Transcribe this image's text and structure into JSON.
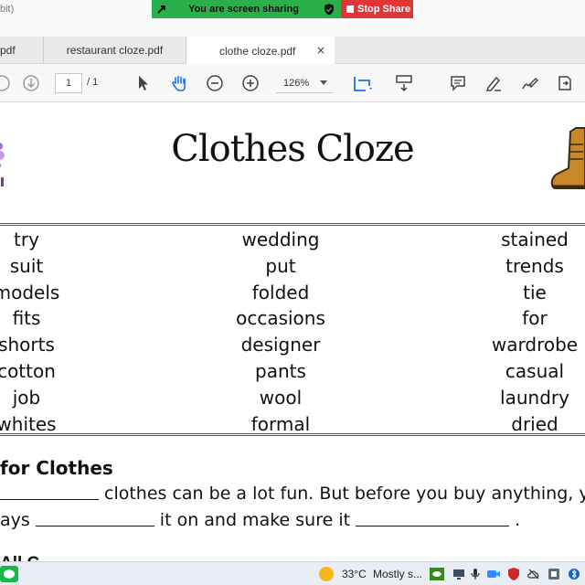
{
  "window": {
    "title_fragment": "bit)"
  },
  "share_bar": {
    "message": "You are screen sharing",
    "stop_label": "Stop Share"
  },
  "tabs": [
    {
      "label": "pdf"
    },
    {
      "label": "restaurant cloze.pdf"
    },
    {
      "label": "clothe cloze.pdf",
      "active": true
    }
  ],
  "tab_close": "×",
  "toolbar": {
    "page_current": "1",
    "page_total": "/ 1",
    "zoom": "126%"
  },
  "document": {
    "title": "Clothes Cloze",
    "word_bank": {
      "col1": [
        "try",
        "suit",
        "models",
        "fits",
        "shorts",
        "cotton",
        "job",
        "whites"
      ],
      "col2": [
        "wedding",
        "put",
        "folded",
        "occasions",
        "designer",
        "pants",
        "wool",
        "formal"
      ],
      "col3": [
        "stained",
        "trends",
        "tie",
        "for",
        "wardrobe",
        "casual",
        "laundry",
        "dried"
      ]
    },
    "section_heading": "for Clothes",
    "line1": {
      "text": "clothes can be a lot fun. But before you buy anything, y"
    },
    "line2": {
      "start": "ays",
      "mid": "it on and make sure it",
      "end": "."
    },
    "line3_fragment": "All C"
  },
  "taskbar": {
    "temperature": "33°C",
    "weather": "Mostly s..."
  },
  "colors": {
    "share_green": "#2ab04a",
    "stop_red": "#e23636",
    "acrobat_blue": "#1a73e8"
  }
}
